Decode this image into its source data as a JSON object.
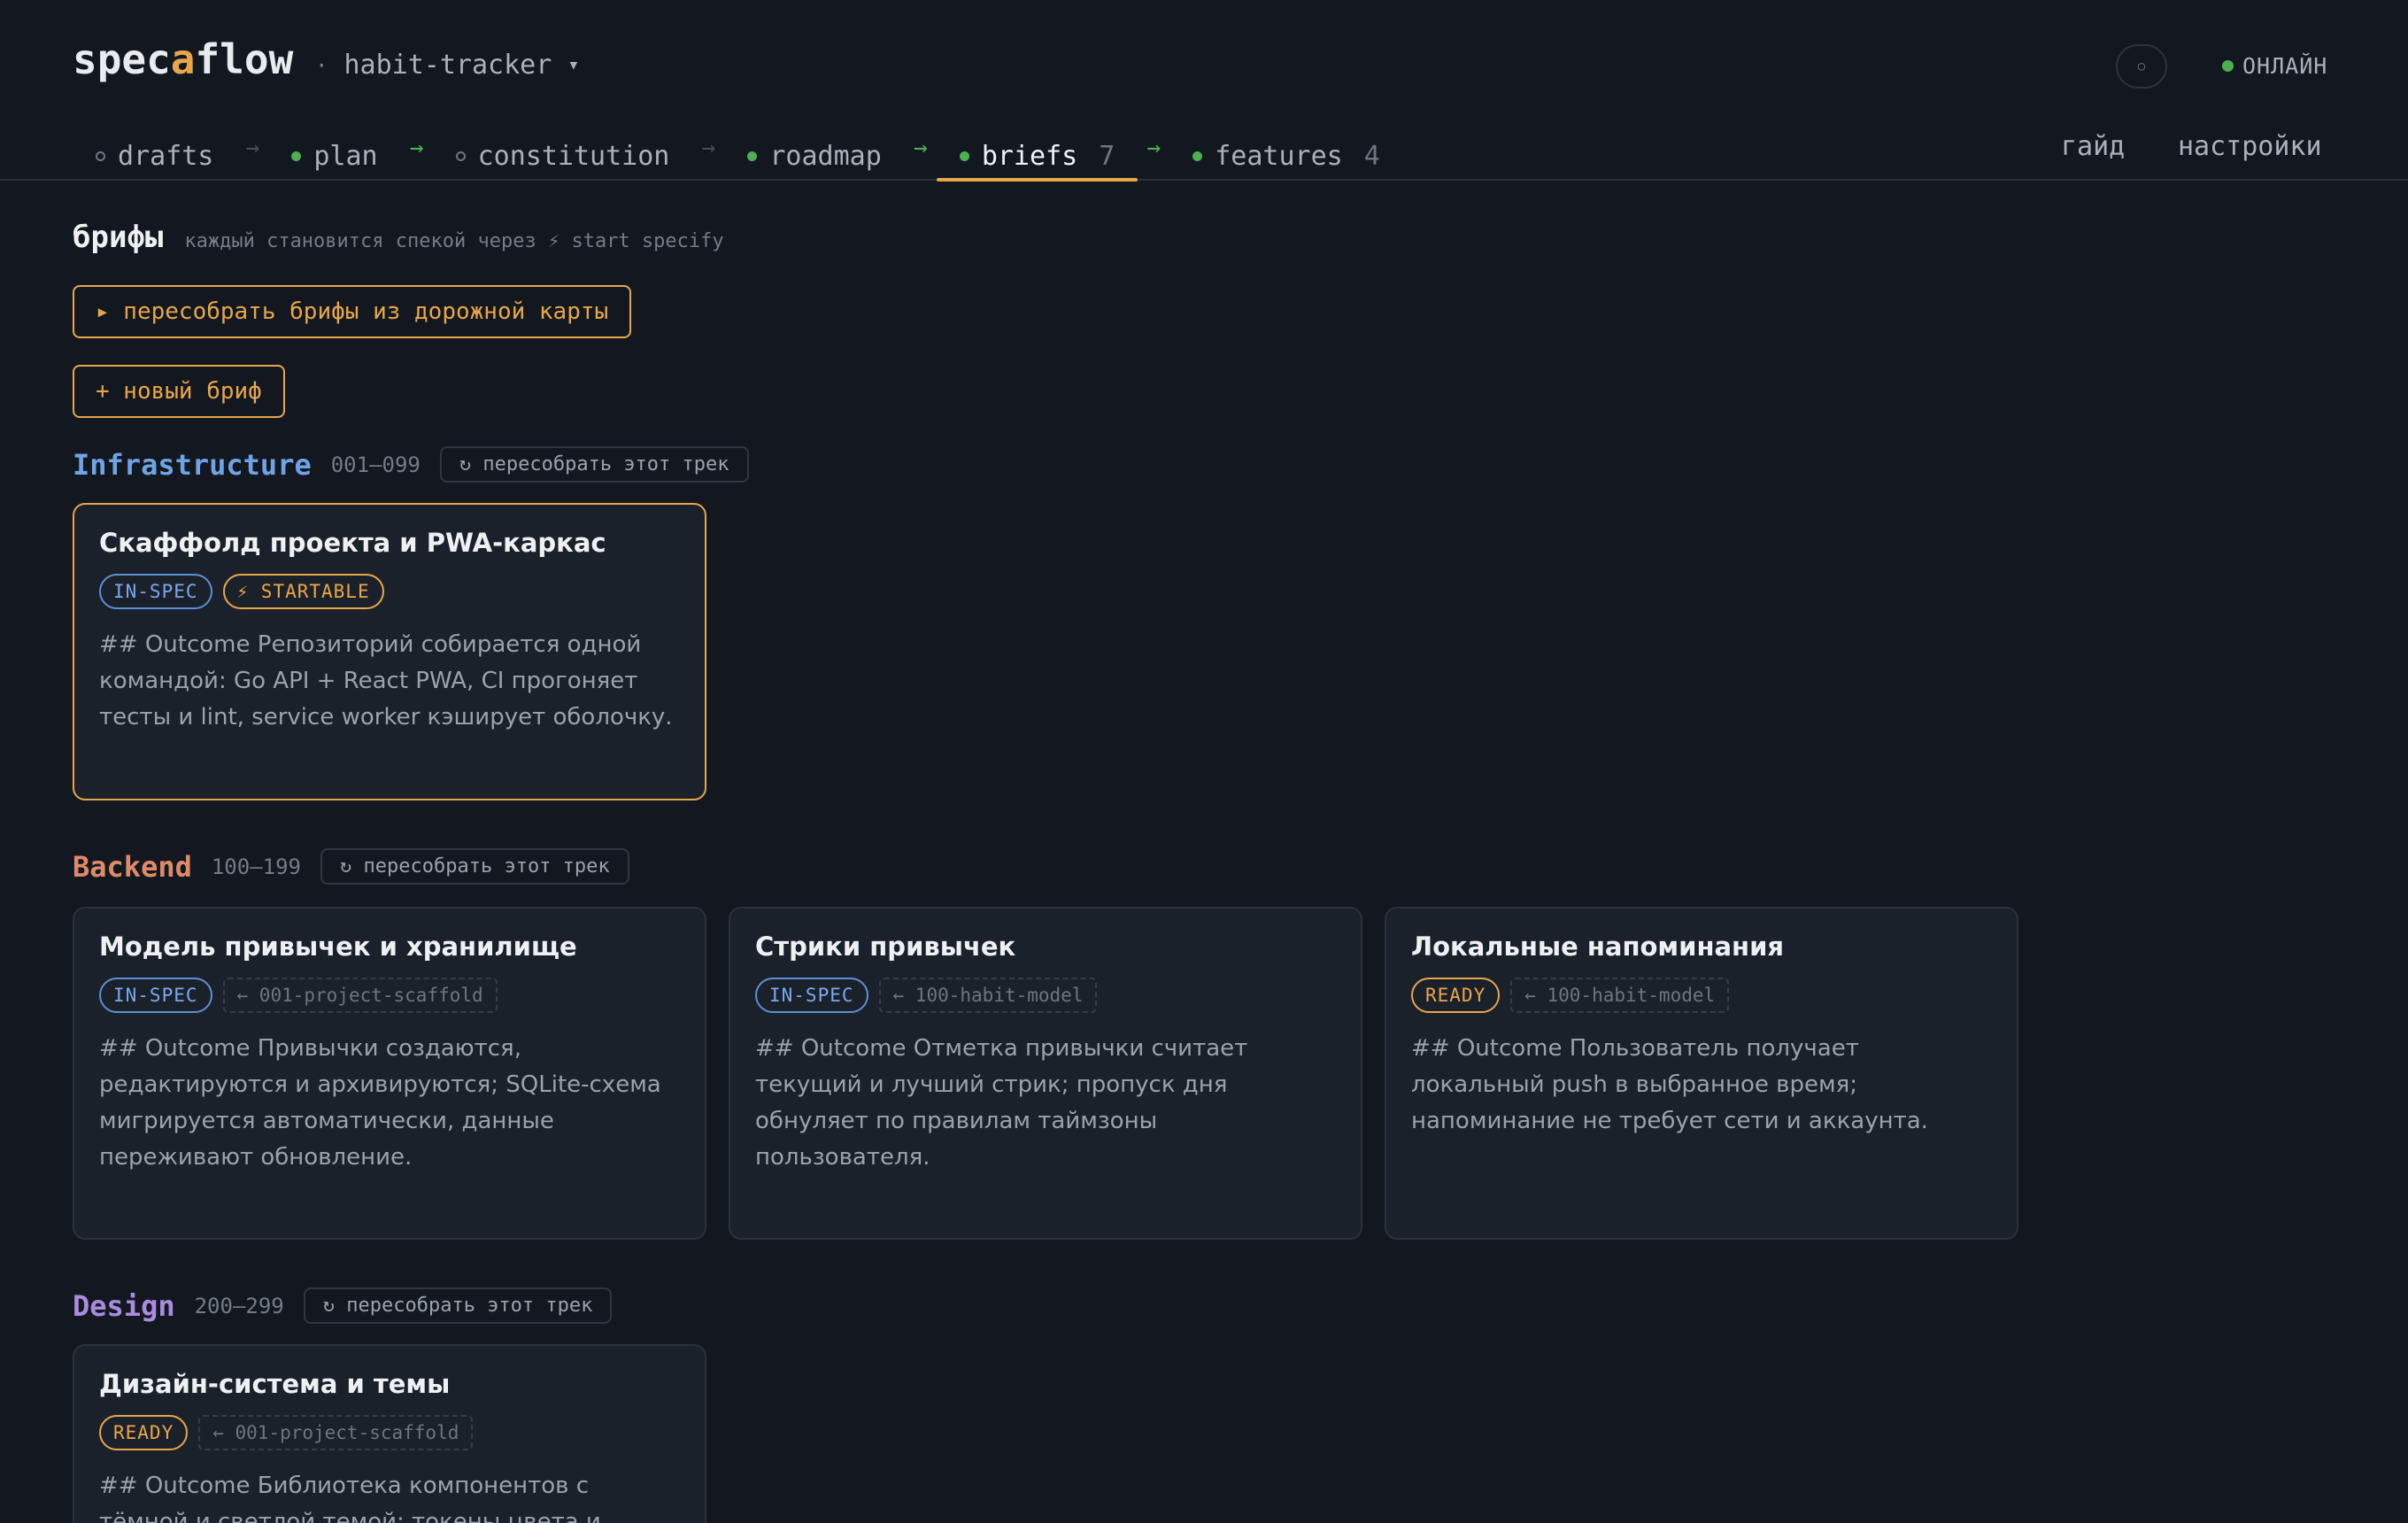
{
  "header": {
    "logo_pre": "spec",
    "logo_accent": "a",
    "logo_post": "flow",
    "project_dot": "·",
    "project_name": "habit-tracker",
    "project_caret": "▾",
    "theme_toggle": "○",
    "status": "ОНЛАЙН"
  },
  "nav": {
    "steps": [
      {
        "label": "drafts"
      },
      {
        "label": "plan"
      },
      {
        "label": "constitution"
      },
      {
        "label": "roadmap"
      },
      {
        "label": "briefs",
        "count": "7"
      },
      {
        "label": "features",
        "count": "4"
      }
    ],
    "arrow": "→",
    "guide": "гайд",
    "settings": "настройки"
  },
  "page": {
    "title": "брифы",
    "hint": "каждый становится спекой через ⚡ start specify",
    "rebuild_all": "▸ пересобрать брифы из дорожной карты",
    "new_brief": "+ новый бриф"
  },
  "tracks": [
    {
      "name": "Infrastructure",
      "range": "001–099",
      "rebuild": "↻ пересобрать этот трек",
      "cards": [
        {
          "title": "Скаффолд проекта и PWA-каркас",
          "status": "IN-SPEC",
          "extra": "⚡ STARTABLE",
          "desc": "## Outcome Репозиторий собирается одной командой: Go API + React PWA, CI прогоняет тесты и lint, service worker кэширует оболочку."
        }
      ]
    },
    {
      "name": "Backend",
      "range": "100–199",
      "rebuild": "↻ пересобрать этот трек",
      "cards": [
        {
          "title": "Модель привычек и хранилище",
          "status": "IN-SPEC",
          "extra": "← 001-project-scaffold",
          "desc": "## Outcome Привычки создаются, редактируются и архивируются; SQLite-схема мигрируется автоматически, данные переживают обновление."
        },
        {
          "title": "Стрики привычек",
          "status": "IN-SPEC",
          "extra": "← 100-habit-model",
          "desc": "## Outcome Отметка привычки считает текущий и лучший стрик; пропуск дня обнуляет по правилам таймзоны пользователя."
        },
        {
          "title": "Локальные напоминания",
          "status": "READY",
          "extra": "← 100-habit-model",
          "desc": "## Outcome Пользователь получает локальный push в выбранное время; напоминание не требует сети и аккаунта."
        }
      ]
    },
    {
      "name": "Design",
      "range": "200–299",
      "rebuild": "↻ пересобрать этот трек",
      "cards": [
        {
          "title": "Дизайн-система и темы",
          "status": "READY",
          "extra": "← 001-project-scaffold",
          "desc": "## Outcome Библиотека компонентов с тёмной и светлой темой; токены цвета и"
        }
      ]
    }
  ],
  "colors": {
    "background": "#131820",
    "accent": "#e8a64a",
    "online": "#4caf50",
    "track_infrastructure": "#6fa3e6",
    "track_backend": "#e08a6a",
    "track_design": "#a98be0"
  }
}
